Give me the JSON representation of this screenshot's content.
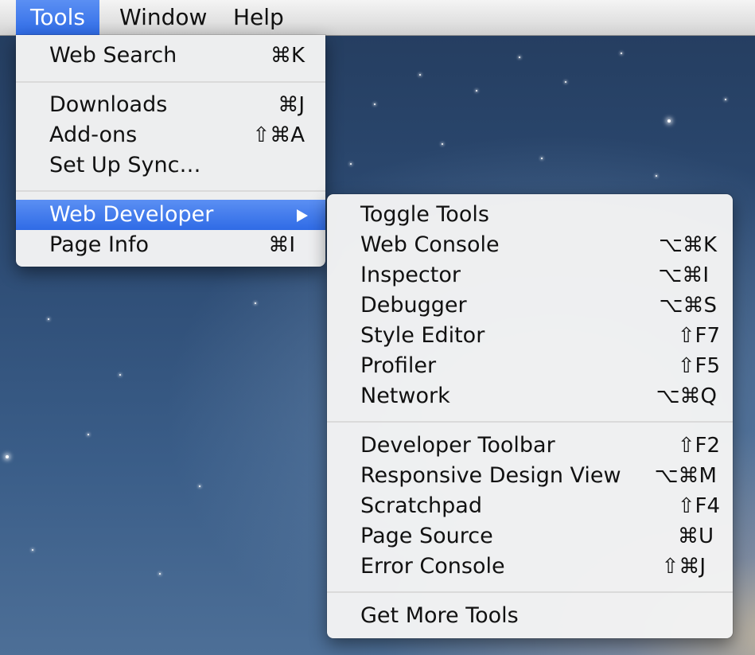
{
  "menubar": {
    "items": [
      {
        "label": "Tools"
      },
      {
        "label": "Window"
      },
      {
        "label": "Help"
      }
    ]
  },
  "tools_menu": {
    "items": [
      {
        "label": "Web Search",
        "shortcut": "⌘K"
      },
      {
        "label": "Downloads",
        "shortcut": "⌘J"
      },
      {
        "label": "Add-ons",
        "shortcut": "⇧⌘A"
      },
      {
        "label": "Set Up Sync…",
        "shortcut": ""
      },
      {
        "label": "Web Developer",
        "shortcut": ""
      },
      {
        "label": "Page Info",
        "shortcut": "⌘I"
      }
    ]
  },
  "web_developer_menu": {
    "items": [
      {
        "label": "Toggle Tools",
        "shortcut": ""
      },
      {
        "label": "Web Console",
        "shortcut": "⌥⌘K"
      },
      {
        "label": "Inspector",
        "shortcut": "⌥⌘I"
      },
      {
        "label": "Debugger",
        "shortcut": "⌥⌘S"
      },
      {
        "label": "Style Editor",
        "shortcut": "⇧F7"
      },
      {
        "label": "Profiler",
        "shortcut": "⇧F5"
      },
      {
        "label": "Network",
        "shortcut": "⌥⌘Q"
      },
      {
        "label": "Developer Toolbar",
        "shortcut": "⇧F2"
      },
      {
        "label": "Responsive Design View",
        "shortcut": "⌥⌘M"
      },
      {
        "label": "Scratchpad",
        "shortcut": "⇧F4"
      },
      {
        "label": "Page Source",
        "shortcut": "⌘U"
      },
      {
        "label": "Error Console",
        "shortcut": "⇧⌘J"
      },
      {
        "label": "Get More Tools",
        "shortcut": ""
      }
    ]
  },
  "colors": {
    "selection": "#3a76ec",
    "menu_background": "#f4f4f4"
  }
}
